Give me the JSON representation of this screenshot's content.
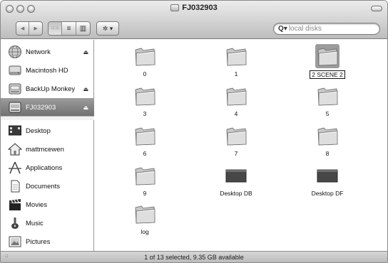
{
  "window": {
    "title": "FJ032903"
  },
  "toolbar": {
    "back_label": "◀",
    "forward_label": "▶",
    "view_icon": "⁙⁙",
    "view_list": "≡",
    "view_columns": "▥",
    "action_label": "✲ ▾"
  },
  "search": {
    "prefix": "Q▾",
    "placeholder": "local disks"
  },
  "sidebar": {
    "devices": [
      {
        "label": "Network",
        "icon": "network-globe-icon",
        "eject": "⏏"
      },
      {
        "label": "Macintosh HD",
        "icon": "hard-disk-icon",
        "eject": ""
      },
      {
        "label": "BackUp Monkey",
        "icon": "external-disk-icon",
        "eject": "⏏"
      },
      {
        "label": "FJ032903",
        "icon": "disk-icon",
        "eject": "⏏"
      }
    ],
    "places": [
      {
        "label": "Desktop",
        "icon": "desktop-icon"
      },
      {
        "label": "mattmcewen",
        "icon": "home-icon"
      },
      {
        "label": "Applications",
        "icon": "applications-icon"
      },
      {
        "label": "Documents",
        "icon": "documents-icon"
      },
      {
        "label": "Movies",
        "icon": "movies-icon"
      },
      {
        "label": "Music",
        "icon": "music-icon"
      },
      {
        "label": "Pictures",
        "icon": "pictures-icon"
      }
    ]
  },
  "files": [
    {
      "name": "0",
      "kind": "folder"
    },
    {
      "name": "1",
      "kind": "folder"
    },
    {
      "name": "2 SCENE 2",
      "kind": "folder",
      "selected": true
    },
    {
      "name": "3",
      "kind": "folder"
    },
    {
      "name": "4",
      "kind": "folder"
    },
    {
      "name": "5",
      "kind": "folder"
    },
    {
      "name": "6",
      "kind": "folder"
    },
    {
      "name": "7",
      "kind": "folder"
    },
    {
      "name": "8",
      "kind": "folder"
    },
    {
      "name": "9",
      "kind": "folder"
    },
    {
      "name": "Desktop DB",
      "kind": "file"
    },
    {
      "name": "Desktop DF",
      "kind": "file"
    },
    {
      "name": "log",
      "kind": "folder"
    }
  ],
  "status": {
    "text": "1 of 13 selected, 9.35 GB available"
  },
  "colors": {
    "selection": "#7a7a7a",
    "folder": "#d6d6d6"
  }
}
